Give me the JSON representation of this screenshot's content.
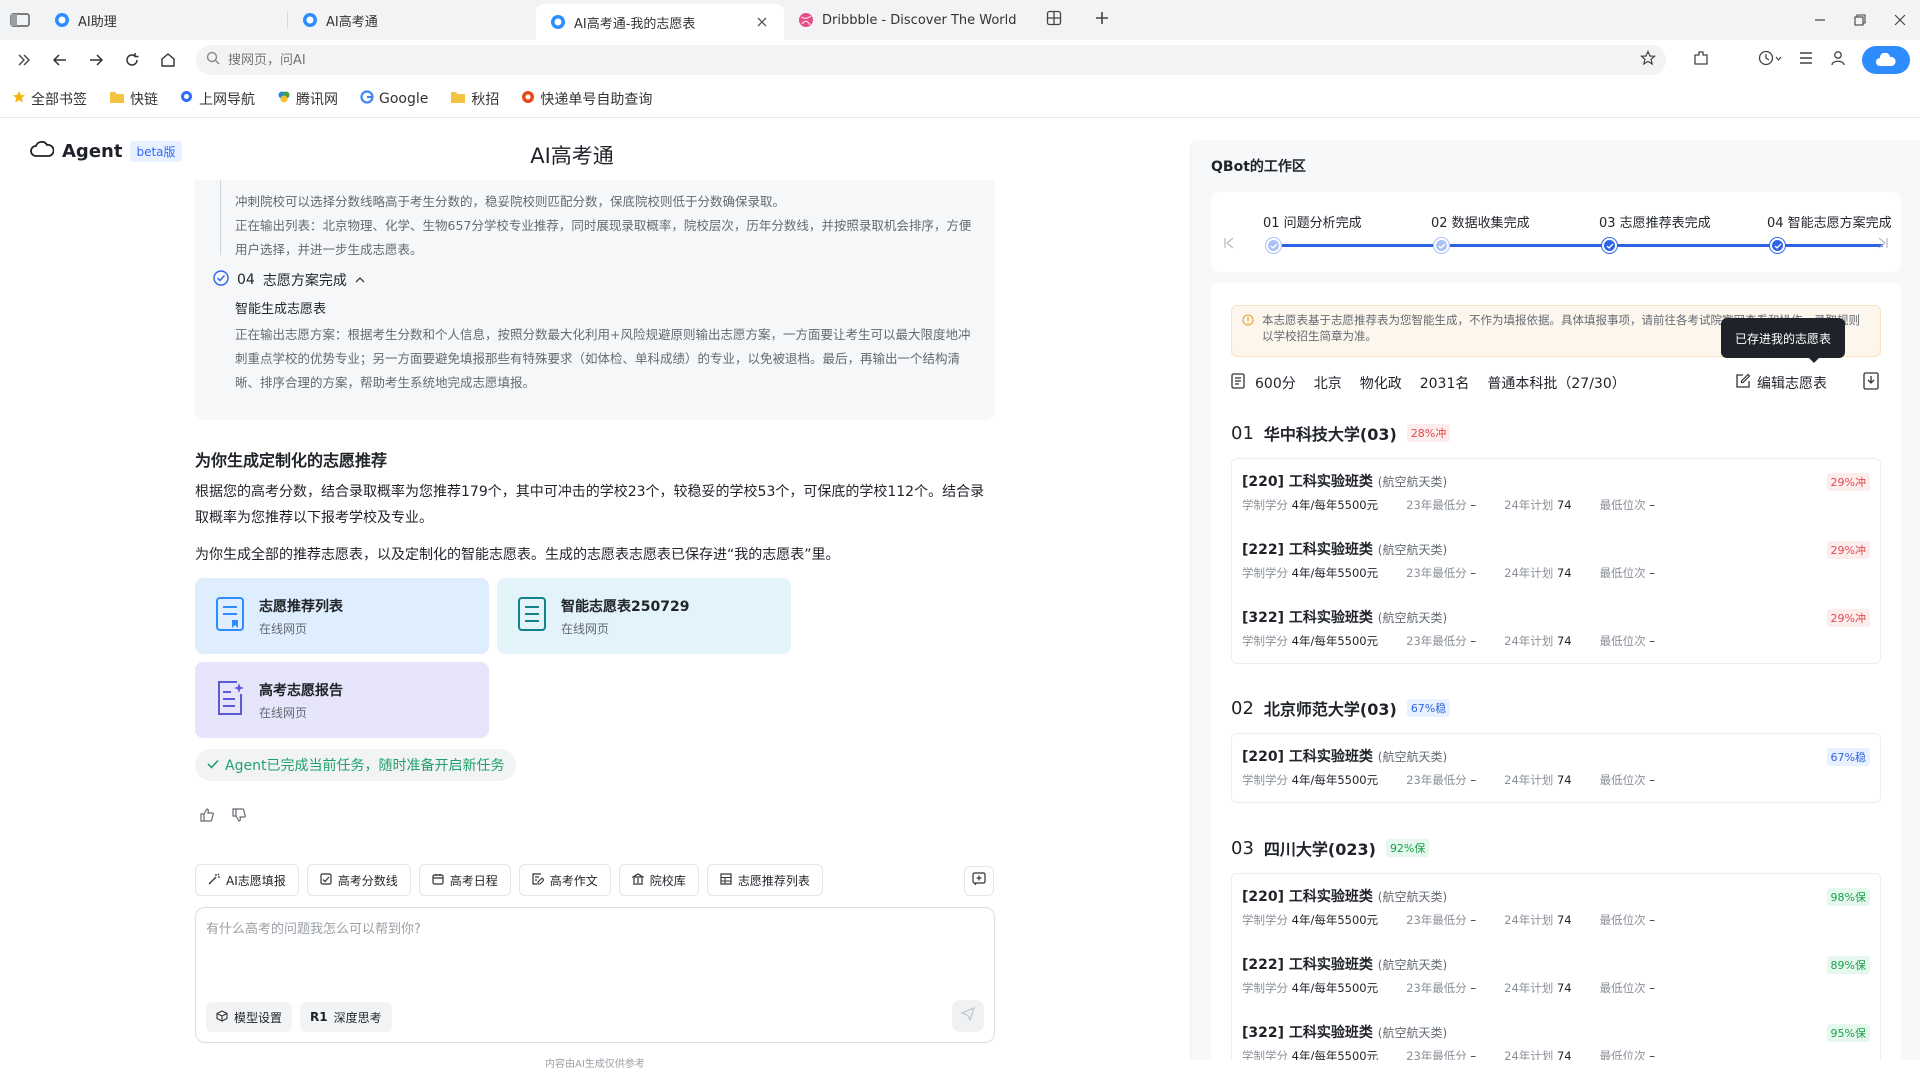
{
  "browser": {
    "tabs": [
      {
        "title": "AI助理"
      },
      {
        "title": "AI高考通"
      },
      {
        "title": "AI高考通-我的志愿表"
      },
      {
        "title": "Dribbble - Discover The World"
      }
    ],
    "address_placeholder": "搜网页，问AI",
    "bookmarks": [
      {
        "label": "全部书签",
        "icon": "star-icon"
      },
      {
        "label": "快链",
        "icon": "folder-icon"
      },
      {
        "label": "上网导航",
        "icon": "search-icon"
      },
      {
        "label": "腾讯网",
        "icon": "tencent-icon"
      },
      {
        "label": "Google",
        "icon": "google-icon"
      },
      {
        "label": "秋招",
        "icon": "folder-icon"
      },
      {
        "label": "快递单号自助查询",
        "icon": "express-icon"
      }
    ]
  },
  "agent": {
    "name": "Agent",
    "badge": "beta版",
    "app_title": "AI高考通"
  },
  "process": {
    "lines": [
      "冲刺院校可以选择分数线略高于考生分数的，稳妥院校则匹配分数，保底院校则低于分数确保录取。",
      "正在输出列表：北京物理、化学、生物657分学校专业推荐，同时展现录取概率，院校层次，历年分数线，并按照录取机会排序，方便用户选择，并进一步生成志愿表。"
    ],
    "step_no": "04",
    "step_label": "志愿方案完成",
    "step_sub": "智能生成志愿表",
    "step_text": "正在输出志愿方案：根据考生分数和个人信息，按照分数最大化利用+风险规避原则输出志愿方案，一方面要让考生可以最大限度地冲刺重点学校的优势专业；另一方面要避免填报那些有特殊要求（如体检、单科成绩）的专业，以免被退档。最后，再输出一个结构清晰、排序合理的方案，帮助考生系统地完成志愿填报。"
  },
  "reply": {
    "title": "为你生成定制化的志愿推荐",
    "para1": "根据您的高考分数，结合录取概率为您推荐179个，其中可冲击的学校23个，较稳妥的学校53个，可保底的学校112个。结合录取概率为您推荐以下报考学校及专业。",
    "para2": "为你生成全部的推荐志愿表，以及定制化的智能志愿表。生成的志愿表志愿表已保存进“我的志愿表”里。",
    "cards": [
      {
        "title": "志愿推荐列表",
        "sub": "在线网页"
      },
      {
        "title": "智能志愿表250729",
        "sub": "在线网页"
      },
      {
        "title": "高考志愿报告",
        "sub": "在线网页"
      }
    ],
    "done": "Agent已完成当前任务，随时准备开启新任务"
  },
  "quick_actions": [
    "AI志愿填报",
    "高考分数线",
    "高考日程",
    "高考作文",
    "院校库",
    "志愿推荐列表"
  ],
  "composer": {
    "placeholder": "有什么高考的问题我怎么可以帮到你?",
    "model_settings": "模型设置",
    "deep_think_prefix": "R1",
    "deep_think": "深度思考",
    "disclaimer": "内容由AI生成仅供参考"
  },
  "workspace": {
    "title": "QBot的工作区",
    "steps": [
      "01 问题分析完成",
      "02 数据收集完成",
      "03 志愿推荐表完成",
      "04 智能志愿方案完成"
    ],
    "notice": "本志愿表基于志愿推荐表为您智能生成，不作为填报依据。具体填报事项，请前往各考试院官网查看和操作，录取规则以学校招生简章为准。",
    "tooltip": "已存进我的志愿表",
    "meta": [
      "600分",
      "北京",
      "物化政",
      "2031名",
      "普通本科批（27/30）"
    ],
    "edit_label": "编辑志愿表",
    "field_labels": {
      "duration": "学制学分",
      "low23": "23年最低分",
      "plan24": "24年计划",
      "rank": "最低位次"
    },
    "universities": [
      {
        "no": "01",
        "name": "华中科技大学(03)",
        "tag": "28%冲",
        "tag_type": "chong",
        "majors": [
          {
            "code": "[220] 工科实验班类",
            "note": "(航空航天类)",
            "duration": "4年/每年5500元",
            "low23": "–",
            "plan24": "74",
            "rank": "–",
            "tag": "29%冲",
            "tag_type": "chong"
          },
          {
            "code": "[222] 工科实验班类",
            "note": "(航空航天类)",
            "duration": "4年/每年5500元",
            "low23": "–",
            "plan24": "74",
            "rank": "–",
            "tag": "29%冲",
            "tag_type": "chong"
          },
          {
            "code": "[322] 工科实验班类",
            "note": "(航空航天类)",
            "duration": "4年/每年5500元",
            "low23": "–",
            "plan24": "74",
            "rank": "–",
            "tag": "29%冲",
            "tag_type": "chong"
          }
        ]
      },
      {
        "no": "02",
        "name": "北京师范大学(03)",
        "tag": "67%稳",
        "tag_type": "wen",
        "majors": [
          {
            "code": "[220] 工科实验班类",
            "note": "(航空航天类)",
            "duration": "4年/每年5500元",
            "low23": "–",
            "plan24": "74",
            "rank": "–",
            "tag": "67%稳",
            "tag_type": "wen"
          }
        ]
      },
      {
        "no": "03",
        "name": "四川大学(023)",
        "tag": "92%保",
        "tag_type": "bao",
        "majors": [
          {
            "code": "[220] 工科实验班类",
            "note": "(航空航天类)",
            "duration": "4年/每年5500元",
            "low23": "–",
            "plan24": "74",
            "rank": "–",
            "tag": "98%保",
            "tag_type": "bao"
          },
          {
            "code": "[222] 工科实验班类",
            "note": "(航空航天类)",
            "duration": "4年/每年5500元",
            "low23": "–",
            "plan24": "74",
            "rank": "–",
            "tag": "89%保",
            "tag_type": "bao"
          },
          {
            "code": "[322] 工科实验班类",
            "note": "(航空航天类)",
            "duration": "4年/每年5500元",
            "low23": "–",
            "plan24": "74",
            "rank": "–",
            "tag": "95%保",
            "tag_type": "bao"
          }
        ]
      }
    ]
  }
}
